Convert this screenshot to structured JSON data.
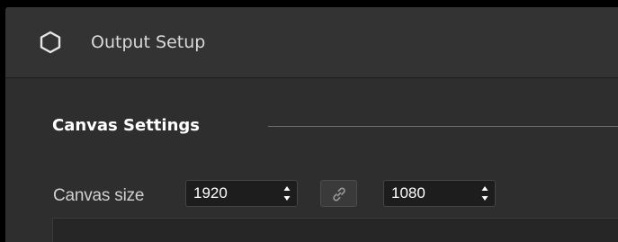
{
  "window": {
    "title": "Output Setup",
    "icon": "hexagon-icon"
  },
  "canvas_settings": {
    "section_title": "Canvas Settings",
    "canvas_size_label": "Canvas size",
    "width_value": "1920",
    "height_value": "1080",
    "link_icon": "link-icon",
    "spin_icon": "spin-arrows-icon"
  },
  "colors": {
    "background": "#2e2e2e",
    "title_bar": "#333333",
    "input_bg": "#1d1d1d",
    "text": "#ffffff",
    "muted_text": "#d0d0d0"
  }
}
